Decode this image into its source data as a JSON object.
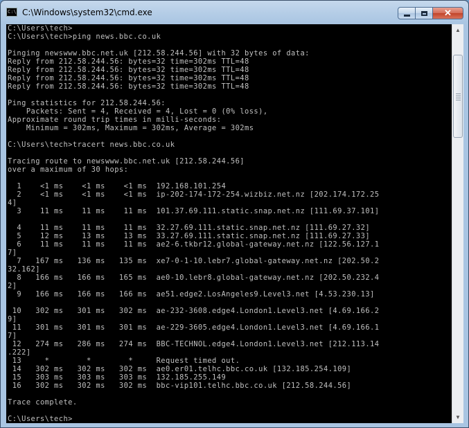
{
  "window": {
    "title": "C:\\Windows\\system32\\cmd.exe",
    "icon": "cmd-icon",
    "controls": {
      "minimize": "minimize-icon",
      "maximize": "maximize-icon",
      "close": "✕"
    }
  },
  "console": {
    "lines": [
      "C:\\Users\\tech>",
      "C:\\Users\\tech>ping news.bbc.co.uk",
      "",
      "Pinging newswww.bbc.net.uk [212.58.244.56] with 32 bytes of data:",
      "Reply from 212.58.244.56: bytes=32 time=302ms TTL=48",
      "Reply from 212.58.244.56: bytes=32 time=302ms TTL=48",
      "Reply from 212.58.244.56: bytes=32 time=302ms TTL=48",
      "Reply from 212.58.244.56: bytes=32 time=302ms TTL=48",
      "",
      "Ping statistics for 212.58.244.56:",
      "    Packets: Sent = 4, Received = 4, Lost = 0 (0% loss),",
      "Approximate round trip times in milli-seconds:",
      "    Minimum = 302ms, Maximum = 302ms, Average = 302ms",
      "",
      "C:\\Users\\tech>tracert news.bbc.co.uk",
      "",
      "Tracing route to newswww.bbc.net.uk [212.58.244.56]",
      "over a maximum of 30 hops:",
      "",
      "  1    <1 ms    <1 ms    <1 ms  192.168.101.254",
      "  2    <1 ms    <1 ms    <1 ms  ip-202-174-172-254.wizbiz.net.nz [202.174.172.25",
      "4]",
      "  3    11 ms    11 ms    11 ms  101.37.69.111.static.snap.net.nz [111.69.37.101]",
      "",
      "  4    11 ms    11 ms    11 ms  32.27.69.111.static.snap.net.nz [111.69.27.32]",
      "  5    12 ms    13 ms    13 ms  33.27.69.111.static.snap.net.nz [111.69.27.33]",
      "  6    11 ms    11 ms    11 ms  ae2-6.tkbr12.global-gateway.net.nz [122.56.127.1",
      "7]",
      "  7   167 ms   136 ms   135 ms  xe7-0-1-10.lebr7.global-gateway.net.nz [202.50.2",
      "32.162]",
      "  8   166 ms   166 ms   165 ms  ae0-10.lebr8.global-gateway.net.nz [202.50.232.4",
      "2]",
      "  9   166 ms   166 ms   166 ms  ae51.edge2.LosAngeles9.Level3.net [4.53.230.13]",
      "",
      " 10   302 ms   301 ms   302 ms  ae-232-3608.edge4.London1.Level3.net [4.69.166.2",
      "9]",
      " 11   301 ms   301 ms   301 ms  ae-229-3605.edge4.London1.Level3.net [4.69.166.1",
      "7]",
      " 12   274 ms   286 ms   274 ms  BBC-TECHNOL.edge4.London1.Level3.net [212.113.14",
      ".222]",
      " 13     *        *        *     Request timed out.",
      " 14   302 ms   302 ms   302 ms  ae0.er01.telhc.bbc.co.uk [132.185.254.109]",
      " 15   303 ms   303 ms   303 ms  132.185.255.149",
      " 16   302 ms   302 ms   302 ms  bbc-vip101.telhc.bbc.co.uk [212.58.244.56]",
      "",
      "Trace complete.",
      "",
      "C:\\Users\\tech>"
    ]
  },
  "colors": {
    "console_bg": "#000000",
    "console_fg": "#c0c0c0",
    "titlebar": "#b3cce6",
    "close_button": "#c1442a"
  }
}
